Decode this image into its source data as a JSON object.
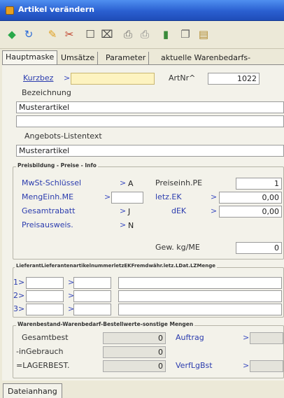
{
  "window": {
    "title": "Artikel verändern"
  },
  "toolbar": {
    "buttons": [
      {
        "name": "back-icon",
        "glyph": "◆",
        "color": "#2aa84a"
      },
      {
        "name": "refresh-icon",
        "glyph": "↻",
        "color": "#2a6ad8"
      },
      {
        "name": "key-icon",
        "glyph": "✎",
        "color": "#e0a020"
      },
      {
        "name": "tools-icon",
        "glyph": "✂",
        "color": "#c0402a"
      },
      {
        "name": "blank-page-icon",
        "glyph": "☐",
        "color": "#444"
      },
      {
        "name": "stop-icon",
        "glyph": "⌧",
        "color": "#444"
      },
      {
        "name": "print-icon",
        "glyph": "⎙",
        "color": "#666"
      },
      {
        "name": "print-preview-icon",
        "glyph": "⎙",
        "color": "#888"
      },
      {
        "name": "export-icon",
        "glyph": "▮",
        "color": "#3a8a3a"
      },
      {
        "name": "copy-icon",
        "glyph": "❐",
        "color": "#666"
      },
      {
        "name": "paste-icon",
        "glyph": "▤",
        "color": "#b08a30"
      }
    ]
  },
  "tabs": [
    "Hauptmaske",
    "Umsätze",
    "Parameter",
    "aktuelle Warenbedarfs-"
  ],
  "main": {
    "kurzbez_label": "Kurzbez",
    "kurzbez_arrow": ">",
    "kurzbez_value": "",
    "artnr_label": "ArtNr^",
    "artnr_value": "1022",
    "bezeichnung_label": "Bezeichnung",
    "bezeichnung_value": "Musterartikel",
    "bezeichnung2_value": "",
    "angebots_label": "Angebots-Listentext",
    "angebots_value": "Musterartikel"
  },
  "preisbildung": {
    "title": "Preisbildung - Preise - Info",
    "mwst_label": "MwSt-Schlüssel",
    "mwst_value": "A",
    "mengeinh_label": "MengEinh.ME",
    "mengeinh_value": "",
    "gesamtrabatt_label": "Gesamtrabatt",
    "gesamtrabatt_value": "J",
    "preisausweis_label": "Preisausweis.",
    "preisausweis_value": "N",
    "preiseinh_label": "Preiseinh.PE",
    "preiseinh_value": "1",
    "letzek_label": "letz.EK",
    "letzek_value": "0,00",
    "dek_label": "dEK",
    "dek_value": "0,00",
    "gew_label": "Gew. kg/ME",
    "gew_value": "0",
    "arrow": ">"
  },
  "lieferant": {
    "title": "LieferantLieferantenartikelnummerletzEKFremdwähr.letz.LDat.LZMenge",
    "rows": [
      {
        "label": "1>",
        "arrow": ">"
      },
      {
        "label": "2>",
        "arrow": ">"
      },
      {
        "label": "3>",
        "arrow": ">"
      }
    ]
  },
  "warenbestand": {
    "title": "Warenbestand-Warenbedarf-Bestellwerte-sonstige Mengen",
    "gesamtbest_label": "Gesamtbest",
    "gesamtbest_value": "0",
    "ingebrauch_label": "-inGebrauch",
    "ingebrauch_value": "0",
    "lagerbest_label": "=LAGERBEST.",
    "lagerbest_value": "0",
    "auftrag_label": "Auftrag",
    "verflgbst_label": "VerfLgBst",
    "arrow": ">"
  },
  "bottom_tabs": [
    "Dateianhang"
  ]
}
